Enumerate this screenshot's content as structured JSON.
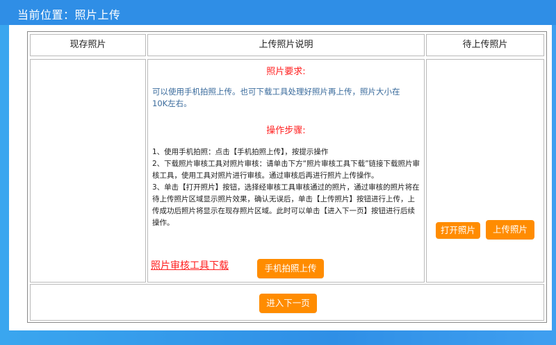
{
  "header": {
    "title": "当前位置：照片上传"
  },
  "table": {
    "col_existing": "现存照片",
    "col_instructions": "上传照片说明",
    "col_pending": "待上传照片"
  },
  "instructions": {
    "requirements_title": "照片要求:",
    "requirements_text": "可以使用手机拍照上传。也可下载工具处理好照片再上传，照片大小在10K左右。",
    "steps_title": "操作步骤:",
    "step1": "1、使用手机拍照：点击【手机拍照上传】，按提示操作",
    "step2": "2、下载照片审核工具对照片审核：请单击下方“照片审核工具下载”链接下载照片审核工具，使用工具对照片进行审核。通过审核后再进行照片上传操作。",
    "step3": "3、单击【打开照片】按钮，选择经审核工具审核通过的照片，通过审核的照片将在待上传照片区域显示照片效果，确认无误后，单击【上传照片】按钮进行上传，上传成功后照片将显示在现存照片区域。此时可以单击【进入下一页】按钮进行后续操作。",
    "download_link": "照片审核工具下载",
    "phone_upload_button": "手机拍照上传"
  },
  "pending": {
    "open_photo_button": "打开照片",
    "upload_photo_button": "上传照片"
  },
  "footer": {
    "next_button": "进入下一页"
  },
  "colors": {
    "accent_orange": "#ff8c00",
    "header_blue": "#2f8ee6",
    "title_red": "#ff1e1e",
    "text_blue": "#3a6b9c"
  }
}
